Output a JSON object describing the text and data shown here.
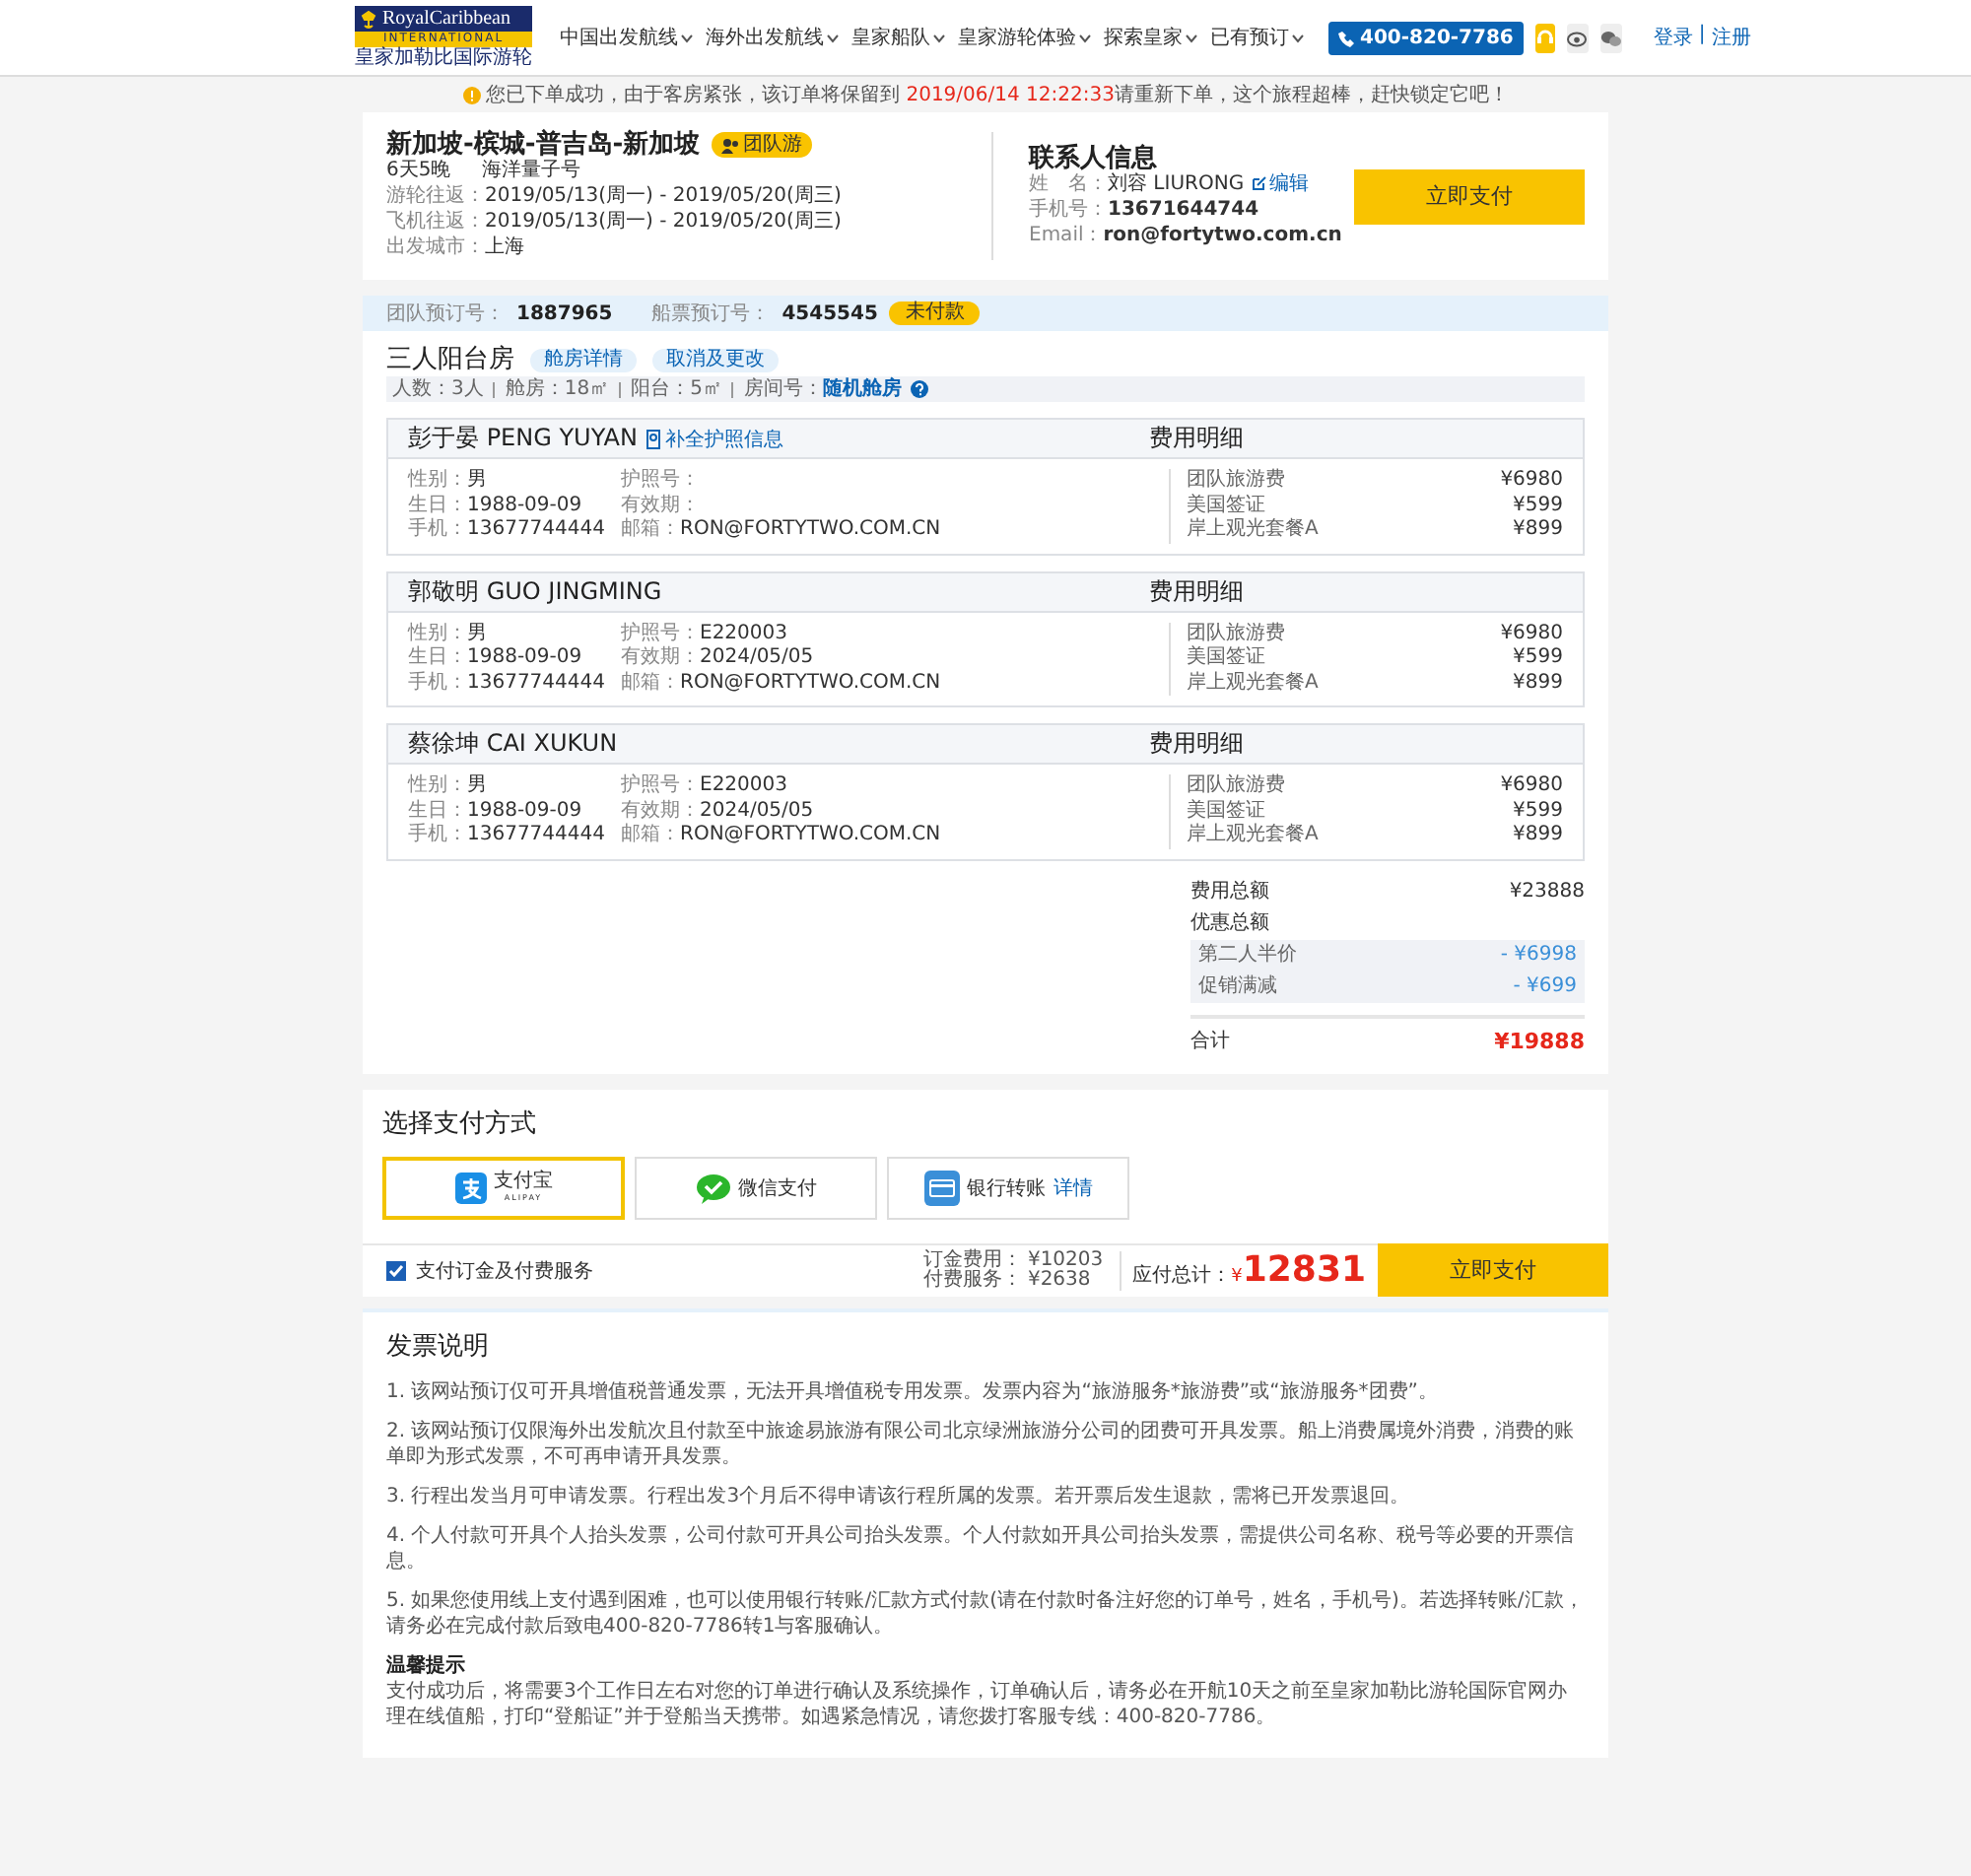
{
  "header": {
    "logo": {
      "brand": "RoyalCaribbean",
      "band": "INTERNATIONAL",
      "cn": "皇家加勒比国际游轮"
    },
    "nav": [
      {
        "label": "中国出发航线"
      },
      {
        "label": "海外出发航线"
      },
      {
        "label": "皇家船队"
      },
      {
        "label": "皇家游轮体验"
      },
      {
        "label": "探索皇家"
      },
      {
        "label": "已有预订"
      }
    ],
    "phone": "400-820-7786",
    "login": "登录",
    "separator": "|",
    "register": "注册"
  },
  "notice": {
    "before": "您已下单成功，由于客房紧张，该订单将保留到 ",
    "highlight": "2019/06/14 12:22:33",
    "after": "请重新下单，这个旅程超棒，赶快锁定它吧！"
  },
  "trip": {
    "title": "新加坡-槟城-普吉岛-新加坡",
    "badge": "团队游",
    "duration": "6天5晚",
    "ship": "海洋量子号",
    "rows": [
      {
        "label": "游轮往返：",
        "value": "2019/05/13(周一) - 2019/05/20(周三)"
      },
      {
        "label": "飞机往返：",
        "value": "2019/05/13(周一) - 2019/05/20(周三)"
      },
      {
        "label": "出发城市：",
        "value": "上海"
      }
    ]
  },
  "contact": {
    "title": "联系人信息",
    "rows": [
      {
        "label": "姓　名：",
        "value": "刘容 LIURONG",
        "action": "编辑"
      },
      {
        "label": "手机号：",
        "value": "13671644744"
      },
      {
        "label": "Email：",
        "value": "ron@fortytwo.com.cn"
      }
    ],
    "pay_button": "立即支付"
  },
  "booking": {
    "group_label": "团队预订号：",
    "group_no": "1887965",
    "ticket_label": "船票预订号：",
    "ticket_no": "4545545",
    "status": "未付款"
  },
  "cabin": {
    "title": "三人阳台房",
    "tags": [
      "舱房详情",
      "取消及更改"
    ],
    "facts": [
      "人数：3人",
      "舱房：18㎡",
      "阳台：5㎡"
    ],
    "room_label": "房间号：",
    "room_link": "随机舱房"
  },
  "guests": [
    {
      "name": "彭于晏 PENG YUYAN",
      "passport_link": "补全护照信息",
      "fee_title": "费用明细",
      "info": [
        {
          "label": "性别：",
          "value": "男"
        },
        {
          "label": "生日：",
          "value": "1988-09-09"
        },
        {
          "label": "手机：",
          "value": "13677744444"
        }
      ],
      "docs": [
        {
          "label": "护照号："
        },
        {
          "label": "有效期："
        },
        {
          "label": "邮箱：",
          "value": "RON@FORTYTWO.COM.CN"
        }
      ],
      "fees": [
        {
          "name": "团队旅游费",
          "amount": "¥6980"
        },
        {
          "name": "美国签证",
          "amount": "¥599"
        },
        {
          "name": "岸上观光套餐A",
          "amount": "¥899"
        }
      ]
    },
    {
      "name": "郭敬明 GUO JINGMING",
      "fee_title": "费用明细",
      "info": [
        {
          "label": "性别：",
          "value": "男"
        },
        {
          "label": "生日：",
          "value": "1988-09-09"
        },
        {
          "label": "手机：",
          "value": "13677744444"
        }
      ],
      "docs": [
        {
          "label": "护照号：",
          "value": "E220003"
        },
        {
          "label": "有效期：",
          "value": "2024/05/05"
        },
        {
          "label": "邮箱：",
          "value": "RON@FORTYTWO.COM.CN"
        }
      ],
      "fees": [
        {
          "name": "团队旅游费",
          "amount": "¥6980"
        },
        {
          "name": "美国签证",
          "amount": "¥599"
        },
        {
          "name": "岸上观光套餐A",
          "amount": "¥899"
        }
      ]
    },
    {
      "name": "蔡徐坤 CAI XUKUN",
      "fee_title": "费用明细",
      "info": [
        {
          "label": "性别：",
          "value": "男"
        },
        {
          "label": "生日：",
          "value": "1988-09-09"
        },
        {
          "label": "手机：",
          "value": "13677744444"
        }
      ],
      "docs": [
        {
          "label": "护照号：",
          "value": "E220003"
        },
        {
          "label": "有效期：",
          "value": "2024/05/05"
        },
        {
          "label": "邮箱：",
          "value": "RON@FORTYTWO.COM.CN"
        }
      ],
      "fees": [
        {
          "name": "团队旅游费",
          "amount": "¥6980"
        },
        {
          "name": "美国签证",
          "amount": "¥599"
        },
        {
          "name": "岸上观光套餐A",
          "amount": "¥899"
        }
      ]
    }
  ],
  "summary": {
    "total_label": "费用总额",
    "total": "¥23888",
    "discount_label": "优惠总额",
    "discounts": [
      {
        "name": "第二人半价",
        "amount": "- ¥6998"
      },
      {
        "name": "促销满减",
        "amount": "- ¥699"
      }
    ],
    "sum_label": "合计",
    "sum": "¥19888"
  },
  "payment": {
    "title": "选择支付方式",
    "methods": [
      {
        "kind": "alipay",
        "label": "支付宝",
        "sub": "ALIPAY",
        "selected": true
      },
      {
        "kind": "wechat",
        "label": "微信支付",
        "selected": false
      },
      {
        "kind": "bank",
        "label": "银行转账",
        "link": "详情",
        "selected": false
      }
    ]
  },
  "checkout": {
    "agree": {
      "label": "支付订金及付费服务",
      "checked": true
    },
    "deposit_label": "订金费用：",
    "deposit": "¥10203",
    "service_label": "付费服务：",
    "service": "¥2638",
    "due_label": "应付总计：",
    "currency": "¥",
    "due": "12831",
    "pay_button": "立即支付"
  },
  "invoice": {
    "title": "发票说明",
    "items": [
      "1. 该网站预订仅可开具增值税普通发票，无法开具增值税专用发票。发票内容为“旅游服务*旅游费”或“旅游服务*团费”。",
      "2. 该网站预订仅限海外出发航次且付款至中旅途易旅游有限公司北京绿洲旅游分公司的团费可开具发票。船上消费属境外消费，消费的账单即为形式发票，不可再申请开具发票。",
      "3. 行程出发当月可申请发票。行程出发3个月后不得申请该行程所属的发票。若开票后发生退款，需将已开发票退回。",
      "4. 个人付款可开具个人抬头发票，公司付款可开具公司抬头发票。个人付款如开具公司抬头发票，需提供公司名称、税号等必要的开票信息。",
      "5. 如果您使用线上支付遇到困难，也可以使用银行转账/汇款方式付款(请在付款时备注好您的订单号，姓名，手机号)。若选择转账/汇款，请务必在完成付款后致电400-820-7786转1与客服确认。"
    ],
    "tip_title": "温馨提示",
    "tip": "支付成功后，将需要3个工作日左右对您的订单进行确认及系统操作，订单确认后，请务必在开航10天之前至皇家加勒比游轮国际官网办理在线值船，打印“登船证”并于登船当天携带。如遇紧急情况，请您拨打客服专线：400-820-7786。"
  }
}
